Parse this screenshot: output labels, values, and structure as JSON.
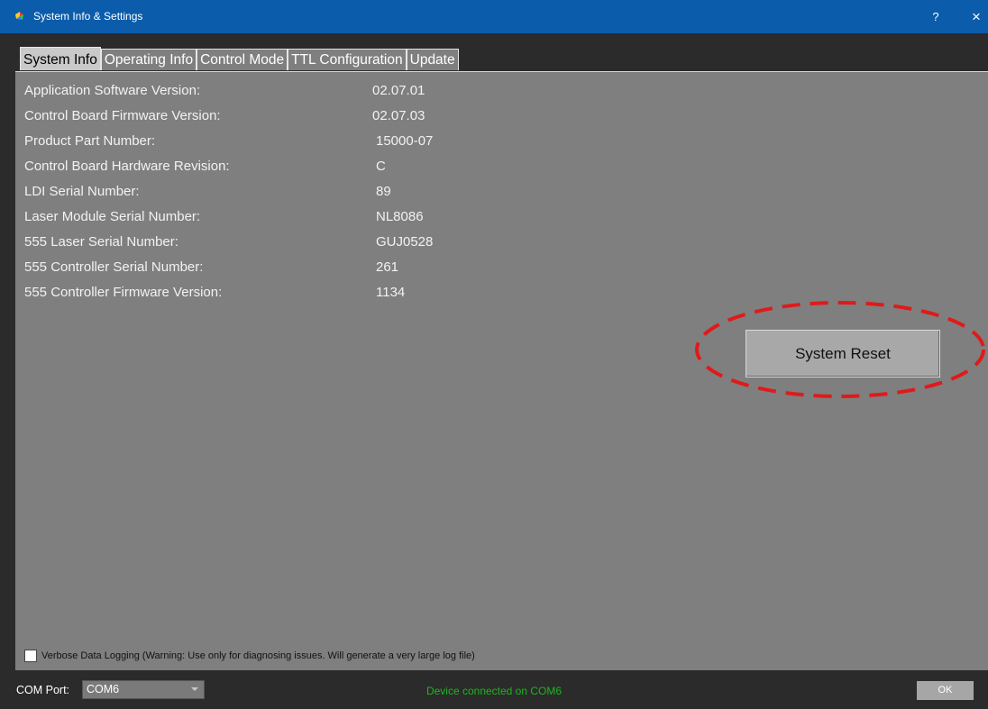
{
  "window": {
    "title": "System Info & Settings",
    "help": "?",
    "close": "×"
  },
  "tabs": [
    {
      "label": "System Info",
      "active": true
    },
    {
      "label": "Operating Info",
      "active": false
    },
    {
      "label": "Control Mode",
      "active": false
    },
    {
      "label": "TTL Configuration",
      "active": false
    },
    {
      "label": "Update",
      "active": false
    }
  ],
  "info": [
    {
      "label": "Application Software Version:",
      "value": "02.07.01"
    },
    {
      "label": "Control Board Firmware Version:",
      "value": "02.07.03"
    },
    {
      "label": "Product Part Number:",
      "value": "15000-07"
    },
    {
      "label": "Control Board Hardware Revision:",
      "value": "C"
    },
    {
      "label": "LDI Serial Number:",
      "value": "89"
    },
    {
      "label": "Laser Module Serial Number:",
      "value": "NL8086"
    },
    {
      "label": "555 Laser Serial Number:",
      "value": "GUJ0528"
    },
    {
      "label": "555 Controller Serial Number:",
      "value": "261"
    },
    {
      "label": "555 Controller Firmware Version:",
      "value": "1134"
    }
  ],
  "system_reset_label": "System Reset",
  "verbose_logging": {
    "label": "Verbose Data Logging (Warning: Use only for diagnosing issues.  Will generate a very large log file)",
    "checked": false
  },
  "footer": {
    "com_port_label": "COM Port:",
    "com_port_value": "COM6",
    "status": "Device connected on COM6",
    "ok_label": "OK"
  },
  "colors": {
    "titlebar": "#0b5cab",
    "panel": "#7f7f7f",
    "status": "#1fb51f",
    "annotation": "#e01a1a"
  }
}
